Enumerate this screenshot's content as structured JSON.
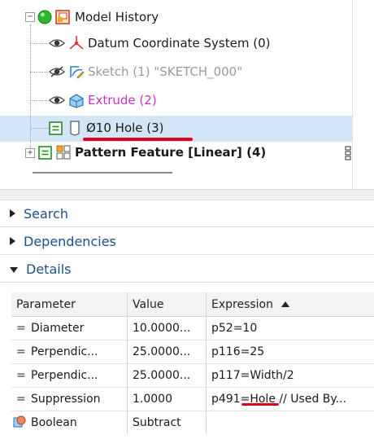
{
  "tree": {
    "root": {
      "label": "Model History",
      "expander": "−"
    },
    "items": [
      {
        "label": "Datum Coordinate System (0)",
        "icon": "datum-csys-icon"
      },
      {
        "label": "Sketch (1) \"SKETCH_000\"",
        "icon": "sketch-icon"
      },
      {
        "label": "Extrude (2)",
        "icon": "extrude-icon"
      },
      {
        "label": "Ø10 Hole (3)",
        "icon": "hole-icon"
      },
      {
        "label": "Pattern Feature [Linear] (4)",
        "icon": "pattern-feature-icon",
        "expander": "+"
      }
    ]
  },
  "panels": {
    "search": "Search",
    "dependencies": "Dependencies",
    "details": "Details"
  },
  "details_table": {
    "headers": {
      "parameter": "Parameter",
      "value": "Value",
      "expression": "Expression"
    },
    "rows": [
      {
        "parameter": "Diameter",
        "value": "10.0000...",
        "expression": "p52=10"
      },
      {
        "parameter": "Perpendic...",
        "value": "25.0000...",
        "expression": "p116=25"
      },
      {
        "parameter": "Perpendic...",
        "value": "25.0000...",
        "expression": "p117=Width/2"
      },
      {
        "parameter": "Suppression",
        "value": "1.0000",
        "expression_prefix": "p491=",
        "expression_highlight": "Hole",
        "expression_suffix": " // Used By..."
      },
      {
        "parameter": "Boolean",
        "value": "Subtract",
        "expression": ""
      }
    ]
  },
  "colors": {
    "selection": "#d2e6f7",
    "annotation_underline": "#e3001b",
    "panel_header_text": "#1f4f8c",
    "extrude_label": "#c832c8"
  }
}
